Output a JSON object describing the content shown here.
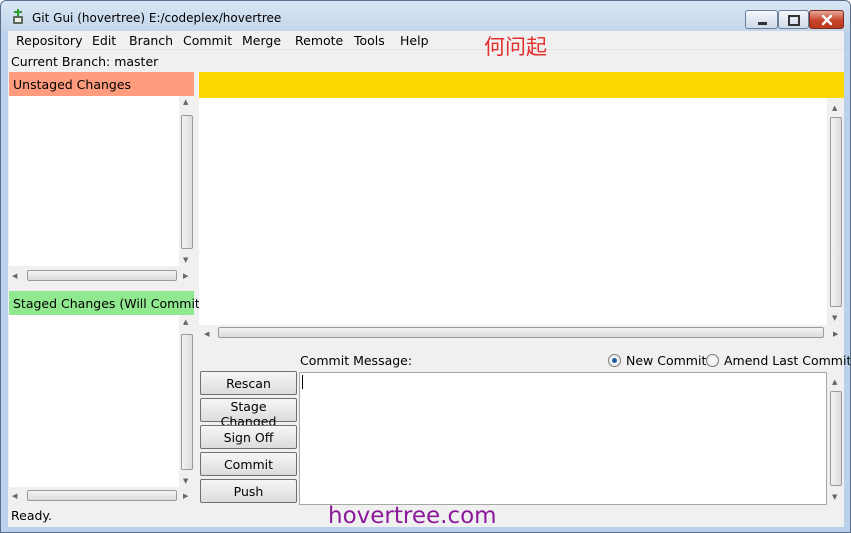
{
  "window": {
    "title": "Git Gui (hovertree) E:/codeplex/hovertree",
    "controls": {
      "minimize": "minimize",
      "maximize": "maximize",
      "close": "close"
    }
  },
  "menu": [
    "Repository",
    "Edit",
    "Branch",
    "Commit",
    "Merge",
    "Remote",
    "Tools",
    "Help"
  ],
  "watermark_top": "何问起",
  "current_branch": "Current Branch: master",
  "unstaged_header": "Unstaged Changes",
  "staged_header": "Staged Changes (Will Commit)",
  "commit": {
    "message_label": "Commit Message:",
    "new_commit_label": "New Commit",
    "amend_label": "Amend Last Commit",
    "mode_selected": "New Commit",
    "message_value": ""
  },
  "buttons": {
    "rescan": "Rescan",
    "stage_changed": "Stage Changed",
    "sign_off": "Sign Off",
    "commit": "Commit",
    "push": "Push"
  },
  "status": "Ready.",
  "watermark_bottom": "hovertree.com",
  "colors": {
    "unstaged_header_bg": "#ff9c7d",
    "staged_header_bg": "#90e98f",
    "diff_header_bg": "#ffd700",
    "watermark_top": "#e62d2d",
    "watermark_bottom": "#8b1a9a"
  }
}
